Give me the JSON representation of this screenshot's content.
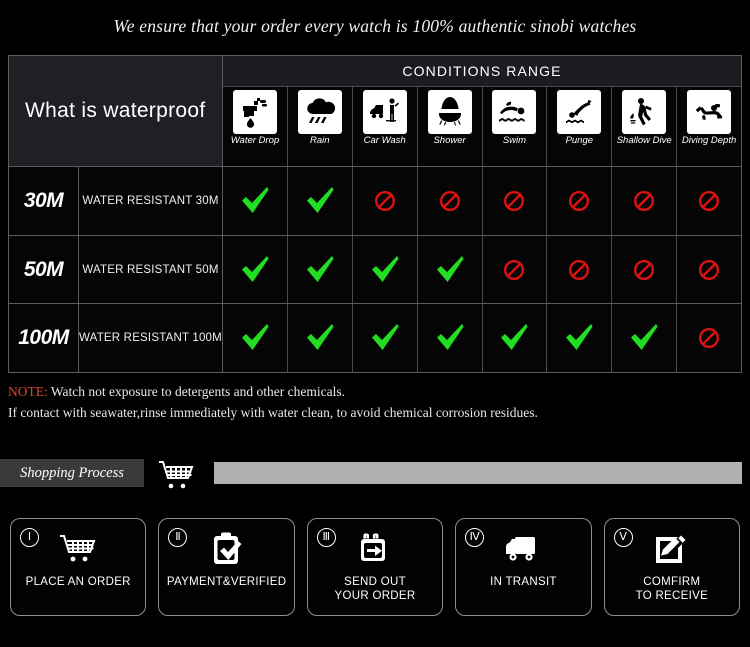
{
  "tagline": "We ensure that your order every watch is 100% authentic sinobi watches",
  "table": {
    "title": "What is waterproof",
    "conditions_header": "CONDITIONS RANGE",
    "columns": [
      {
        "label": "Water Drop",
        "icon": "faucet-drop-icon"
      },
      {
        "label": "Rain",
        "icon": "rain-cloud-icon"
      },
      {
        "label": "Car Wash",
        "icon": "car-wash-icon"
      },
      {
        "label": "Shower",
        "icon": "shower-icon"
      },
      {
        "label": "Swim",
        "icon": "swimmer-icon"
      },
      {
        "label": "Punge",
        "icon": "plunge-dive-icon"
      },
      {
        "label": "Shallow\nDive",
        "icon": "shallow-dive-icon"
      },
      {
        "label": "Diving\nDepth",
        "icon": "scuba-diver-icon"
      }
    ],
    "rows": [
      {
        "depth": "30M",
        "description": "WATER RESISTANT  30M",
        "values": [
          "yes",
          "yes",
          "no",
          "no",
          "no",
          "no",
          "no",
          "no"
        ]
      },
      {
        "depth": "50M",
        "description": "WATER RESISTANT 50M",
        "values": [
          "yes",
          "yes",
          "yes",
          "yes",
          "no",
          "no",
          "no",
          "no"
        ]
      },
      {
        "depth": "100M",
        "description": "WATER RESISTANT  100M",
        "values": [
          "yes",
          "yes",
          "yes",
          "yes",
          "yes",
          "yes",
          "yes",
          "no"
        ]
      }
    ]
  },
  "note": {
    "label": "NOTE:",
    "line1": " Watch not exposure to detergents and other chemicals.",
    "line2": "If contact with seawater,rinse immediately with water clean, to avoid chemical corrosion residues."
  },
  "shopping": {
    "tag": "Shopping Process",
    "cart_icon": "shopping-cart-icon"
  },
  "steps": [
    {
      "num": "Ⅰ",
      "label": "PLACE AN ORDER",
      "icon": "shopping-cart-icon"
    },
    {
      "num": "Ⅱ",
      "label": "PAYMENT&VERIFIED",
      "icon": "clipboard-check-icon"
    },
    {
      "num": "Ⅲ",
      "label": "SEND OUT\nYOUR ORDER",
      "icon": "package-arrow-icon"
    },
    {
      "num": "Ⅳ",
      "label": "IN TRANSIT",
      "icon": "delivery-truck-icon"
    },
    {
      "num": "Ⅴ",
      "label": "COMFIRM\nTO RECEIVE",
      "icon": "edit-pencil-icon"
    }
  ],
  "colors": {
    "check_green": "#22dd22",
    "prohibit_red": "#dd1111",
    "note_red": "#e0452e",
    "rule_gray": "#b0b0b0",
    "tag_gray": "#3a3a3a",
    "title_cell": "#1e2025"
  }
}
